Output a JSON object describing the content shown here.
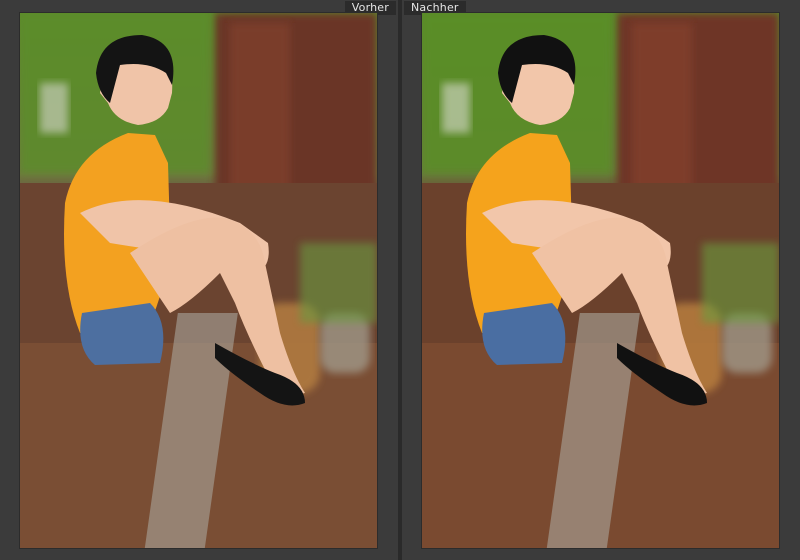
{
  "compare_view": {
    "before_label": "Vorher",
    "after_label": "Nachher"
  },
  "colors": {
    "background": "#3b3b3b",
    "label_bg": "#2b2b2b",
    "label_text": "#e6e6e6"
  },
  "images": {
    "before": {
      "icon": "photo-before-image"
    },
    "after": {
      "icon": "photo-after-image"
    }
  }
}
